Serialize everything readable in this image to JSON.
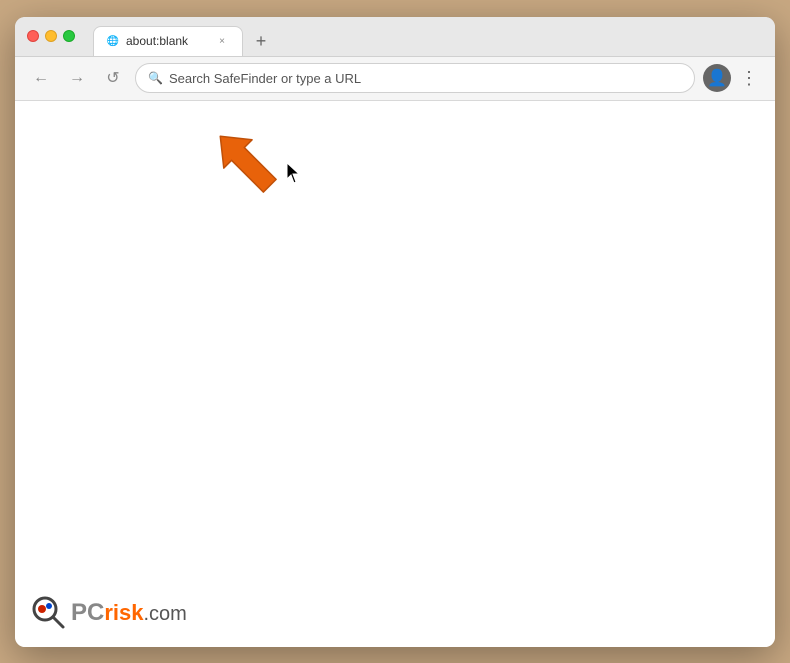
{
  "browser": {
    "tab": {
      "title": "about:blank",
      "favicon": "🌐"
    },
    "new_tab_label": "+",
    "nav": {
      "back_label": "←",
      "forward_label": "→",
      "reload_label": "↺",
      "address_placeholder": "Search SafeFinder or type a URL"
    },
    "account_icon_label": "👤",
    "more_icon_label": "⋮",
    "tab_close_label": "×"
  },
  "watermark": {
    "pc_text": "PC",
    "risk_text": "risk",
    "com_text": ".com"
  },
  "colors": {
    "close_light": "#ff5f57",
    "minimize_light": "#ffbd2e",
    "maximize_light": "#28c840",
    "arrow_fill": "#e8620a",
    "arrow_stroke": "#c0500a"
  }
}
